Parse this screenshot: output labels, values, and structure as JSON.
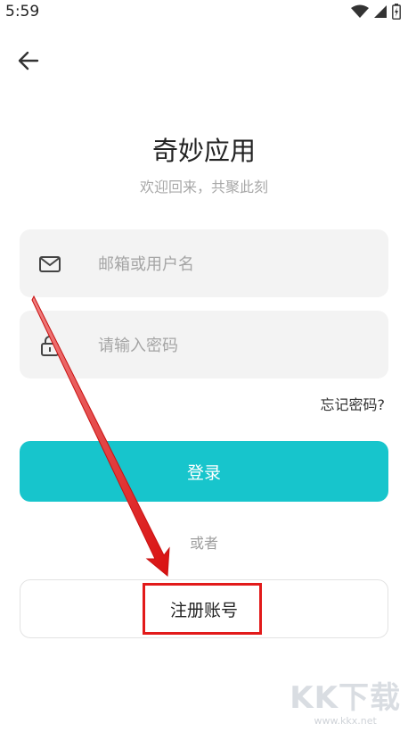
{
  "status_bar": {
    "time": "5:59",
    "icons": [
      "wifi-icon",
      "signal-icon",
      "battery-icon"
    ]
  },
  "header": {
    "back_icon": "arrow-left-icon"
  },
  "app": {
    "title": "奇妙应用",
    "subtitle": "欢迎回来，共聚此刻"
  },
  "form": {
    "username_placeholder": "邮箱或用户名",
    "username_value": "",
    "username_icon": "mail-icon",
    "password_placeholder": "请输入密码",
    "password_value": "",
    "password_icon": "lock-icon",
    "forgot_label": "忘记密码?",
    "login_label": "登录",
    "or_label": "或者",
    "register_label": "注册账号"
  },
  "watermark": {
    "logo": "KK下载",
    "url": "www.kkx.net"
  },
  "colors": {
    "accent": "#17c5cc",
    "annotation": "#e21a1a",
    "field_bg": "#f3f3f3"
  }
}
